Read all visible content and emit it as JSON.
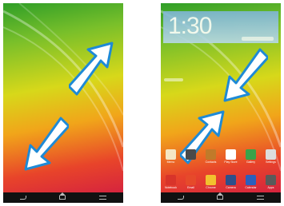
{
  "left_screen": {
    "name": "blank-home-screen"
  },
  "right_screen": {
    "clock": "1:30",
    "apps_row1": [
      {
        "label": "Memo",
        "icon": "memo-icon",
        "color": "#f5e7c4"
      },
      {
        "label": "",
        "icon": "app-icon",
        "color": "#4a4a4a"
      },
      {
        "label": "Contacts",
        "icon": "contacts-icon",
        "color": "#c07a2a"
      },
      {
        "label": "Play Store",
        "icon": "play-store-icon",
        "color": "#ffffff"
      },
      {
        "label": "Gallery",
        "icon": "gallery-icon",
        "color": "#3aa34a"
      },
      {
        "label": "Settings",
        "icon": "settings-icon",
        "color": "#dddddd"
      }
    ],
    "apps_row2": [
      {
        "label": "Notebook",
        "icon": "notebook-icon",
        "color": "#d8342a"
      },
      {
        "label": "Email",
        "icon": "email-icon",
        "color": "#e64a2a"
      },
      {
        "label": "Chrome",
        "icon": "chrome-icon",
        "color": "#f2c12e"
      },
      {
        "label": "Camera",
        "icon": "camera-icon",
        "color": "#2d4f8a"
      },
      {
        "label": "Calendar",
        "icon": "calendar-icon",
        "color": "#2b5fbd"
      },
      {
        "label": "Apps",
        "icon": "apps-grid-icon",
        "color": "#5a5a5a"
      }
    ]
  },
  "colors": {
    "arrow_fill": "#ffffff",
    "arrow_stroke": "#1e8ad6"
  }
}
